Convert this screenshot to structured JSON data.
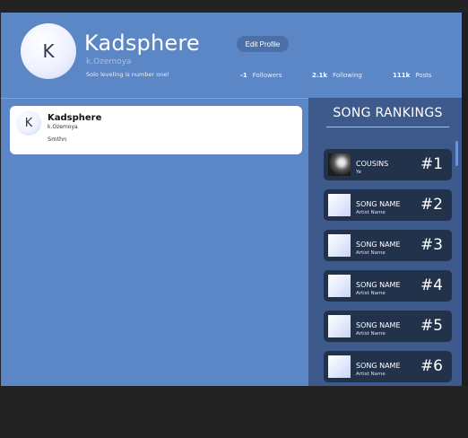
{
  "profile": {
    "avatar_letter": "K",
    "name": "Kadsphere",
    "handle": "k.Ozemoya",
    "bio": "Solo leveling is number one!",
    "edit_label": "Edit Profile"
  },
  "stats": [
    {
      "value": "-1",
      "label": "Followers"
    },
    {
      "value": "2.1k",
      "label": "Following"
    },
    {
      "value": "111k",
      "label": "Posts"
    }
  ],
  "post": {
    "avatar_letter": "K",
    "name": "Kadsphere",
    "handle": "k.Ozemoya",
    "text": "Smthn"
  },
  "rankings": {
    "title": "SONG RANKINGS",
    "items": [
      {
        "song": "COUSINS",
        "artist": "Ye",
        "rank": "#1"
      },
      {
        "song": "SONG NAME",
        "artist": "Artist Name",
        "rank": "#2"
      },
      {
        "song": "SONG NAME",
        "artist": "Artist Name",
        "rank": "#3"
      },
      {
        "song": "SONG NAME",
        "artist": "Artist Name",
        "rank": "#4"
      },
      {
        "song": "SONG NAME",
        "artist": "Artist Name",
        "rank": "#5"
      },
      {
        "song": "SONG NAME",
        "artist": "Artist Name",
        "rank": "#6"
      }
    ]
  },
  "colors": {
    "background": "#5b87c7",
    "panel": "#3e5a8c",
    "card": "#23324b",
    "button": "#4c6fa8"
  }
}
